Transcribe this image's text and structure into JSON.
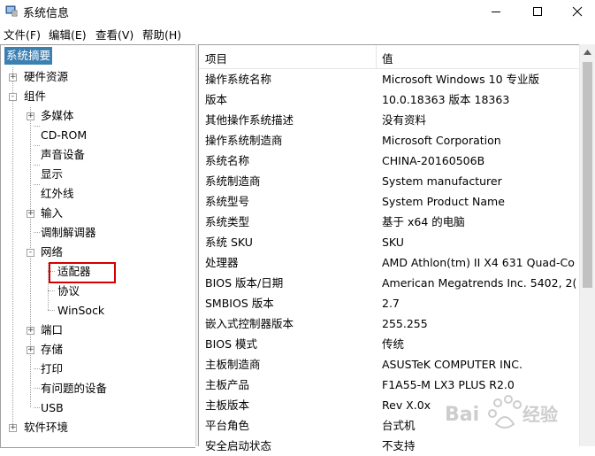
{
  "window": {
    "title": "系统信息",
    "minimize_icon": "minimize-icon",
    "maximize_icon": "maximize-icon",
    "close_icon": "close-icon"
  },
  "menu": [
    "文件(F)",
    "编辑(E)",
    "查看(V)",
    "帮助(H)"
  ],
  "tree": {
    "root": "系统摘要",
    "items": [
      {
        "label": "硬件资源",
        "expander": "+"
      },
      {
        "label": "组件",
        "expander": "-"
      },
      {
        "label": "多媒体",
        "expander": "+"
      },
      {
        "label": "CD-ROM"
      },
      {
        "label": "声音设备"
      },
      {
        "label": "显示"
      },
      {
        "label": "红外线"
      },
      {
        "label": "输入",
        "expander": "+"
      },
      {
        "label": "调制解调器"
      },
      {
        "label": "网络",
        "expander": "-"
      },
      {
        "label": "适配器"
      },
      {
        "label": "协议"
      },
      {
        "label": "WinSock"
      },
      {
        "label": "端口",
        "expander": "+"
      },
      {
        "label": "存储",
        "expander": "+"
      },
      {
        "label": "打印"
      },
      {
        "label": "有问题的设备"
      },
      {
        "label": "USB"
      },
      {
        "label": "软件环境",
        "expander": "+"
      }
    ]
  },
  "list": {
    "headers": {
      "item": "项目",
      "value": "值"
    },
    "rows": [
      {
        "item": "操作系统名称",
        "value": "Microsoft Windows 10 专业版"
      },
      {
        "item": "版本",
        "value": "10.0.18363 版本 18363"
      },
      {
        "item": "其他操作系统描述",
        "value": "没有资料"
      },
      {
        "item": "操作系统制造商",
        "value": "Microsoft Corporation"
      },
      {
        "item": "系统名称",
        "value": "CHINA-20160506B"
      },
      {
        "item": "系统制造商",
        "value": "System manufacturer"
      },
      {
        "item": "系统型号",
        "value": "System Product Name"
      },
      {
        "item": "系统类型",
        "value": "基于 x64 的电脑"
      },
      {
        "item": "系统 SKU",
        "value": "SKU"
      },
      {
        "item": "处理器",
        "value": "AMD Athlon(tm) II X4 631 Quad-Co"
      },
      {
        "item": "BIOS 版本/日期",
        "value": "American Megatrends Inc. 5402, 2("
      },
      {
        "item": "SMBIOS 版本",
        "value": "2.7"
      },
      {
        "item": "嵌入式控制器版本",
        "value": "255.255"
      },
      {
        "item": "BIOS 模式",
        "value": "传统"
      },
      {
        "item": "主板制造商",
        "value": "ASUSTeK COMPUTER INC."
      },
      {
        "item": "主板产品",
        "value": "F1A55-M LX3 PLUS R2.0"
      },
      {
        "item": "主板版本",
        "value": "Rev X.0x"
      },
      {
        "item": "平台角色",
        "value": "台式机"
      },
      {
        "item": "安全启动状态",
        "value": "不支持"
      }
    ]
  },
  "colors": {
    "selection": "#3c7fb1",
    "highlight_box": "#d40000",
    "watermark": "#c8c8c8"
  },
  "watermark": "Baidu经验"
}
